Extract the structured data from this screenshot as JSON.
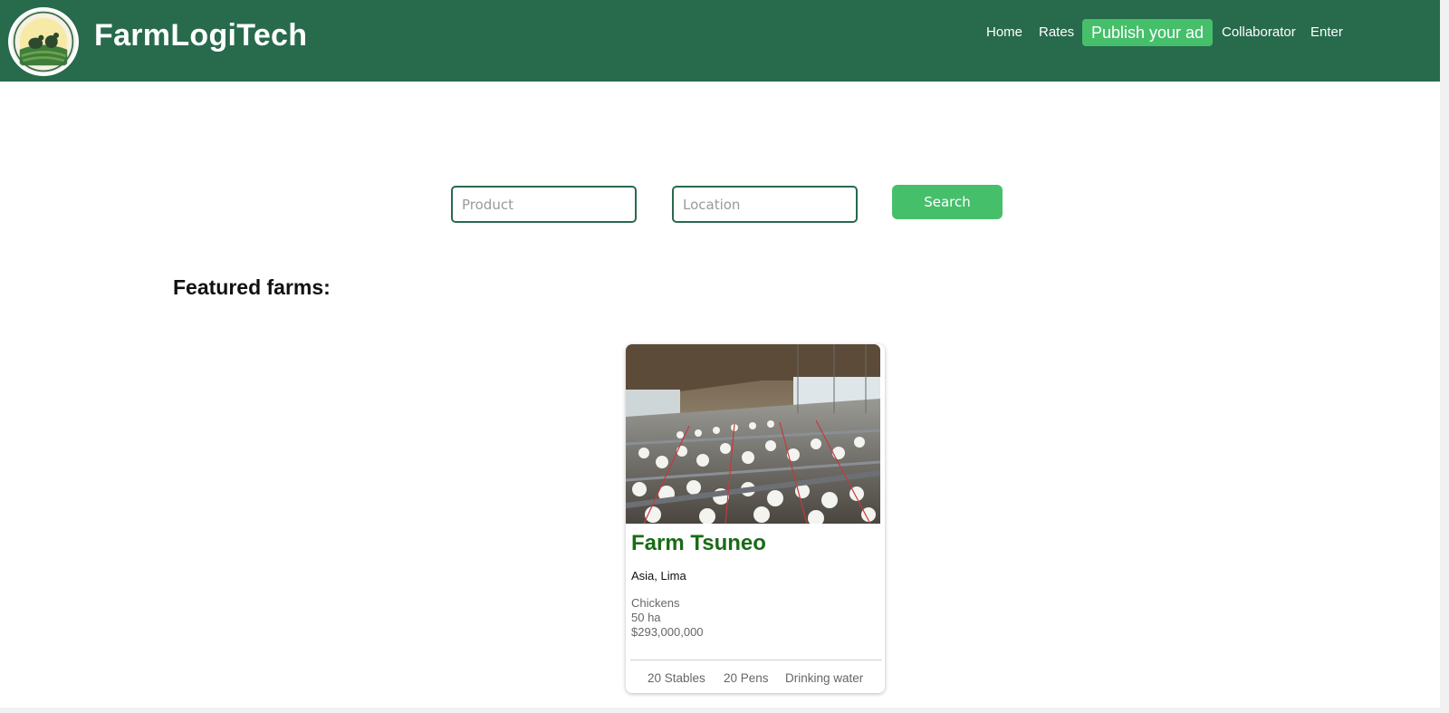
{
  "header": {
    "brand": "FarmLogiTech",
    "logo_icon": "farm-logo-icon",
    "nav": {
      "home": "Home",
      "rates": "Rates",
      "publish": "Publish your ad",
      "collaborator": "Collaborator",
      "enter": "Enter"
    }
  },
  "search": {
    "product_placeholder": "Product",
    "location_placeholder": "Location",
    "button": "Search"
  },
  "featured": {
    "title": "Featured farms:",
    "card": {
      "image_icon": "poultry-house-photo",
      "name": "Farm Tsuneo",
      "location": "Asia, Lima",
      "product": "Chickens",
      "area": "50 ha",
      "price": "$293,000,000",
      "features": [
        "20 Stables",
        "20 Pens",
        "Drinking water"
      ]
    }
  },
  "colors": {
    "header_bg": "#276a4c",
    "accent_green": "#46bf6b",
    "farm_title": "#1a6b16"
  }
}
